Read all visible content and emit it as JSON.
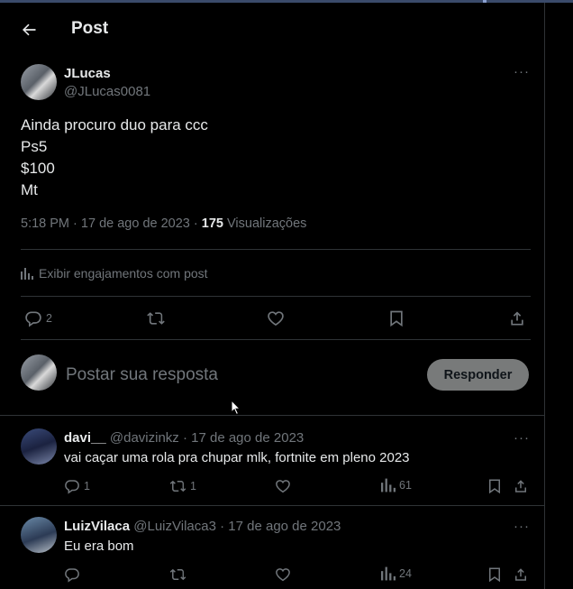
{
  "header": {
    "title": "Post"
  },
  "post": {
    "author_name": "JLucas",
    "author_handle": "@JLucas0081",
    "lines": [
      "Ainda procuro duo para ccc",
      "Ps5",
      "$100",
      "Mt"
    ],
    "time": "5:18 PM",
    "date": "17 de ago de 2023",
    "views": "175",
    "views_label": "Visualizações",
    "engagement_label": "Exibir engajamentos com post",
    "reply_count": "2",
    "more": "···"
  },
  "composer": {
    "placeholder": "Postar sua resposta",
    "button_label": "Responder"
  },
  "replies": [
    {
      "name": "davi__",
      "handle": "@davizinkz",
      "date": "17 de ago de 2023",
      "text": "vai caçar uma rola pra chupar mlk, fortnite em pleno 2023",
      "replies": "1",
      "reposts": "1",
      "views": "61",
      "more": "···"
    },
    {
      "name": "LuizVilaca",
      "handle": "@LuizVilaca3",
      "date": "17 de ago de 2023",
      "text": "Eu era bom",
      "replies": "",
      "reposts": "",
      "views": "24",
      "more": "···"
    }
  ],
  "separator": "·",
  "colors": {
    "background": "#000000",
    "text": "#e7e9ea",
    "muted": "#71767b",
    "border": "#2f3336",
    "button": "#787a7a"
  }
}
